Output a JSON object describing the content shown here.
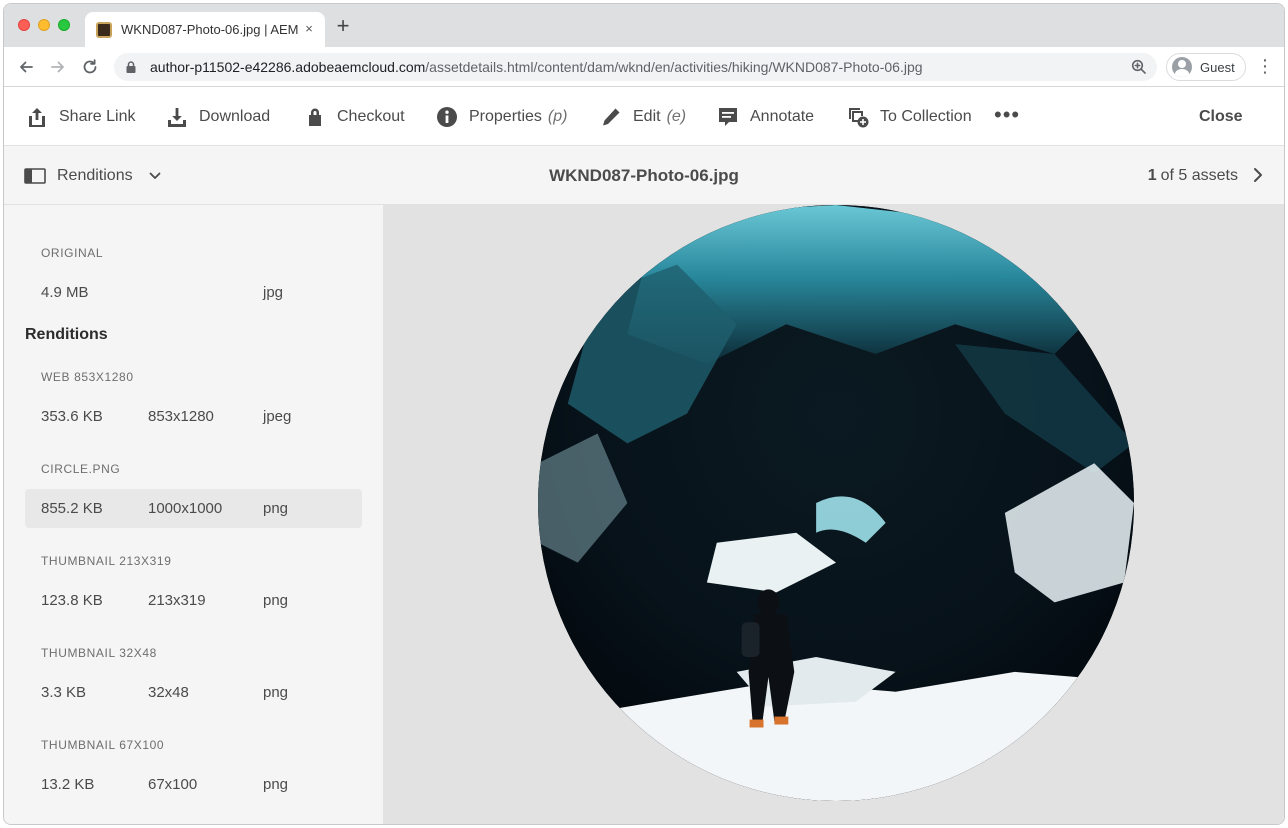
{
  "browser": {
    "tab_title": "WKND087-Photo-06.jpg | AEM",
    "tab_close": "×",
    "new_tab": "+",
    "url_host": "author-p11502-e42286.adobeaemcloud.com",
    "url_path": "/assetdetails.html/content/dam/wknd/en/activities/hiking/WKND087-Photo-06.jpg",
    "profile_label": "Guest",
    "menu": "⋮"
  },
  "actions": {
    "share_link": "Share Link",
    "download": "Download",
    "checkout": "Checkout",
    "properties": "Properties",
    "properties_shortcut": "(p)",
    "edit": "Edit",
    "edit_shortcut": "(e)",
    "annotate": "Annotate",
    "to_collection": "To Collection",
    "more": "•••",
    "close": "Close"
  },
  "subheader": {
    "rail_label": "Renditions",
    "asset_title": "WKND087-Photo-06.jpg",
    "count_current": "1",
    "count_rest": "of 5 assets"
  },
  "rail": {
    "original_label": "ORIGINAL",
    "original": {
      "size": "4.9 MB",
      "dim": "",
      "fmt": "jpg"
    },
    "renditions_heading": "Renditions",
    "renditions": [
      {
        "label": "WEB 853X1280",
        "size": "353.6 KB",
        "dim": "853x1280",
        "fmt": "jpeg"
      },
      {
        "label": "CIRCLE.PNG",
        "size": "855.2 KB",
        "dim": "1000x1000",
        "fmt": "png"
      },
      {
        "label": "THUMBNAIL 213X319",
        "size": "123.8 KB",
        "dim": "213x319",
        "fmt": "png"
      },
      {
        "label": "THUMBNAIL 32X48",
        "size": "3.3 KB",
        "dim": "32x48",
        "fmt": "png"
      },
      {
        "label": "THUMBNAIL 67X100",
        "size": "13.2 KB",
        "dim": "67x100",
        "fmt": "png"
      }
    ],
    "selected_rendition": "CIRCLE.PNG"
  },
  "colors": {
    "rail_bg": "#f5f5f5",
    "preview_bg": "#e2e2e2",
    "selected_row": "#e8e8e8",
    "ice_blue": "#3fa6b8"
  }
}
